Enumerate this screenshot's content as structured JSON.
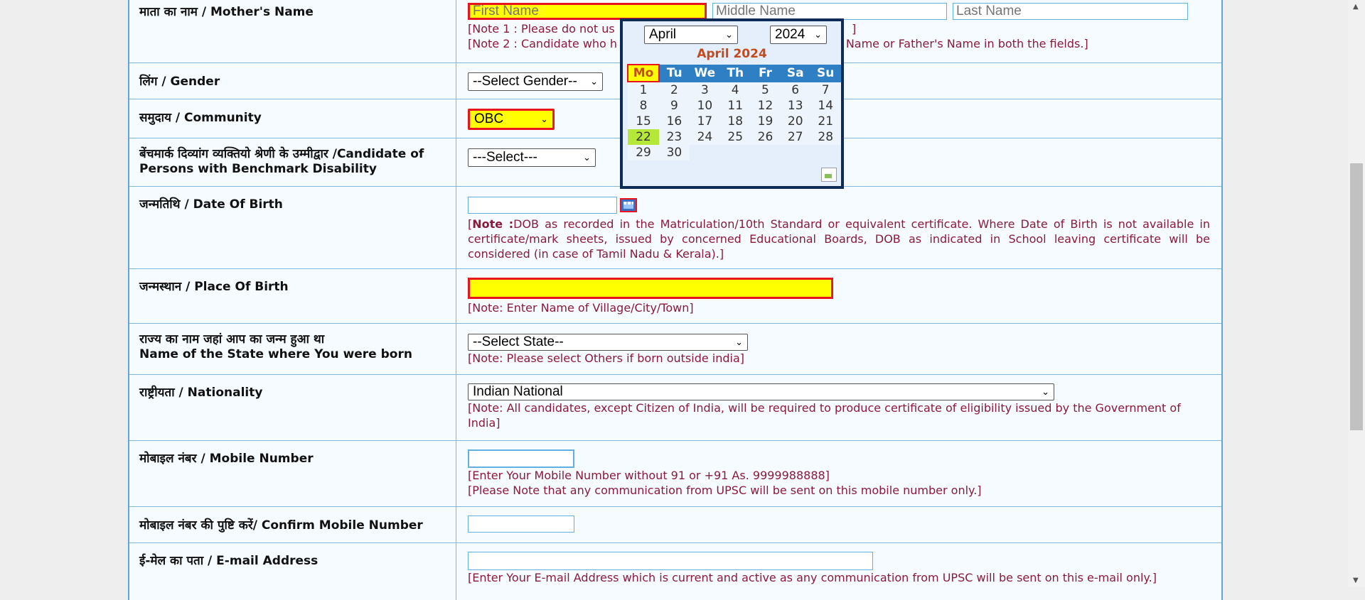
{
  "fields": {
    "mother": {
      "label": "माता का नाम / Mother's Name",
      "first_placeholder": "First Name",
      "middle_placeholder": "Middle Name",
      "last_placeholder": "Last Name",
      "note1": "[Note 1 : Please do not us",
      "note1_tail": "]",
      "note2": "[Note 2 : Candidate who h",
      "note2_tail": "'s Name or Father's Name in both the fields.]"
    },
    "gender": {
      "label": "लिंग / Gender",
      "value": "--Select Gender--"
    },
    "community": {
      "label": "समुदाय / Community",
      "value": "OBC"
    },
    "disability": {
      "label_line1": "बेंचमार्क दिव्यांग व्यक्तियो श्रेणी के उम्मीद्वार /Candidate of",
      "label_line2": "Persons with Benchmark Disability",
      "value": "---Select---"
    },
    "dob": {
      "label": "जन्मतिथि / Date Of Birth",
      "value": "",
      "note_bold": "Note :",
      "note": "DOB as recorded in the Matriculation/10th Standard or equivalent certificate. Where Date of Birth is not available in certificate/mark sheets, issued by concerned Educational Boards, DOB as indicated in School leaving certificate will be considered (in case of Tamil Nadu & Kerala).]"
    },
    "pob": {
      "label": "जन्मस्थान / Place Of Birth",
      "value": "",
      "note": "[Note: Enter Name of Village/City/Town]"
    },
    "state": {
      "label_line1": "राज्य का नाम जहां आप का जन्म हुआ था",
      "label_line2": "Name of the State where You were born",
      "value": "--Select State--",
      "note": "[Note: Please select Others if born outside india]"
    },
    "nationality": {
      "label": "राष्ट्रीयता / Nationality",
      "value": "Indian National",
      "note": "[Note: All candidates, except Citizen of India, will be required to produce certificate of eligibility issued by the Government of India]"
    },
    "mobile": {
      "label": "मोबाइल नंबर / Mobile Number",
      "value": "",
      "note1": "[Enter Your Mobile Number without 91 or +91 As. 9999988888]",
      "note2": "[Please Note that any communication from UPSC will be sent on this mobile number only.]"
    },
    "confirm_mobile": {
      "label": "मोबाइल नंबर की पुष्टि करें/ Confirm Mobile Number",
      "value": ""
    },
    "email": {
      "label": "ई-मेल का पता / E-mail Address",
      "value": "",
      "note": "[Enter Your E-mail Address which is current and active as any communication from UPSC will be sent on this e-mail only.]"
    }
  },
  "calendar": {
    "month": "April",
    "year": "2024",
    "title": "April 2024",
    "weekdays": [
      "Mo",
      "Tu",
      "We",
      "Th",
      "Fr",
      "Sa",
      "Su"
    ],
    "weeks": [
      [
        "1",
        "2",
        "3",
        "4",
        "5",
        "6",
        "7"
      ],
      [
        "8",
        "9",
        "10",
        "11",
        "12",
        "13",
        "14"
      ],
      [
        "15",
        "16",
        "17",
        "18",
        "19",
        "20",
        "21"
      ],
      [
        "22",
        "23",
        "24",
        "25",
        "26",
        "27",
        "28"
      ],
      [
        "29",
        "30",
        "",
        "",
        "",
        "",
        ""
      ]
    ],
    "today": "22"
  },
  "colors": {
    "required_bg": "#ffff00",
    "required_border": "#e8141e",
    "note": "#8b1a3a"
  }
}
